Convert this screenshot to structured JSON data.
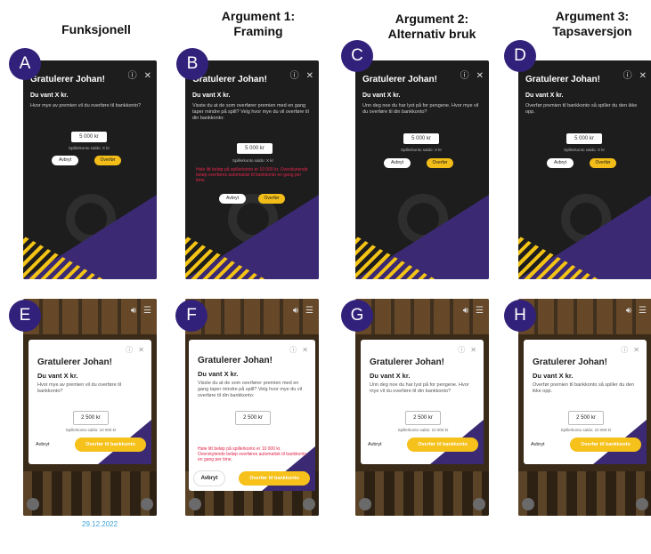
{
  "columns": [
    "Funksjonell",
    "Argument 1:\nFraming",
    "Argument 2:\nAlternativ bruk",
    "Argument 3:\nTapsaversjon"
  ],
  "letters": [
    "A",
    "B",
    "C",
    "D",
    "E",
    "F",
    "G",
    "H"
  ],
  "dark_dialog": {
    "title": "Gratulerer Johan!",
    "subtitle": "Du vant X kr.",
    "amount": "5 000 kr",
    "saldo": "Spillerkonto saldo: X kr",
    "cancel": "Avbryt",
    "transfer": "Overfør",
    "bodies": [
      "Hvor mye av premien vil du overføre til bankkonto?",
      "Visste du at de som overfører premien med en gang taper mindre på spill? Velg hvor mye du vil overføre til din bankkonto:",
      "Unn deg noe du har lyst på for pengene. Hvor mye vil du overføre til din bankkonto?",
      "Overfør premien til bankkonto så spiller du den ikke opp."
    ],
    "warning": "Hele litt beløp på spillerkonto er 10 000 kr. Overskytende beløp overføres automatisk til bankkonto en gang per time."
  },
  "white_dialog": {
    "title": "Gratulerer Johan!",
    "subtitle": "Du vant X kr.",
    "amount": "2 500 kr",
    "saldo": "Spillerkonto saldo: 10 000 kr",
    "cancel": "Avbryt",
    "transfer": "Overfør til bankkonto",
    "bodies": [
      "Hvor mye av premien vil du overføre til bankkonto?",
      "Visste du at de som overfører premien med en gang taper mindre på spill? Velg hvor mye du vil overføre til din bankkonto:",
      "Unn deg noe du har lyst på for pengene. Hvor mye vil du overføre til din bankkonto?",
      "Overfør premien til bankkonto så spiller du den ikke opp."
    ],
    "warning": "Høie litt beløp på spillerkonto er 10 000 kr. Overskytende beløp overføres automatisk til bankkonto en gang per time."
  },
  "icons": {
    "info": "ⓘ",
    "close": "✕",
    "sound": "🔊︎",
    "menu": "☰"
  },
  "date": "29.12.2022"
}
